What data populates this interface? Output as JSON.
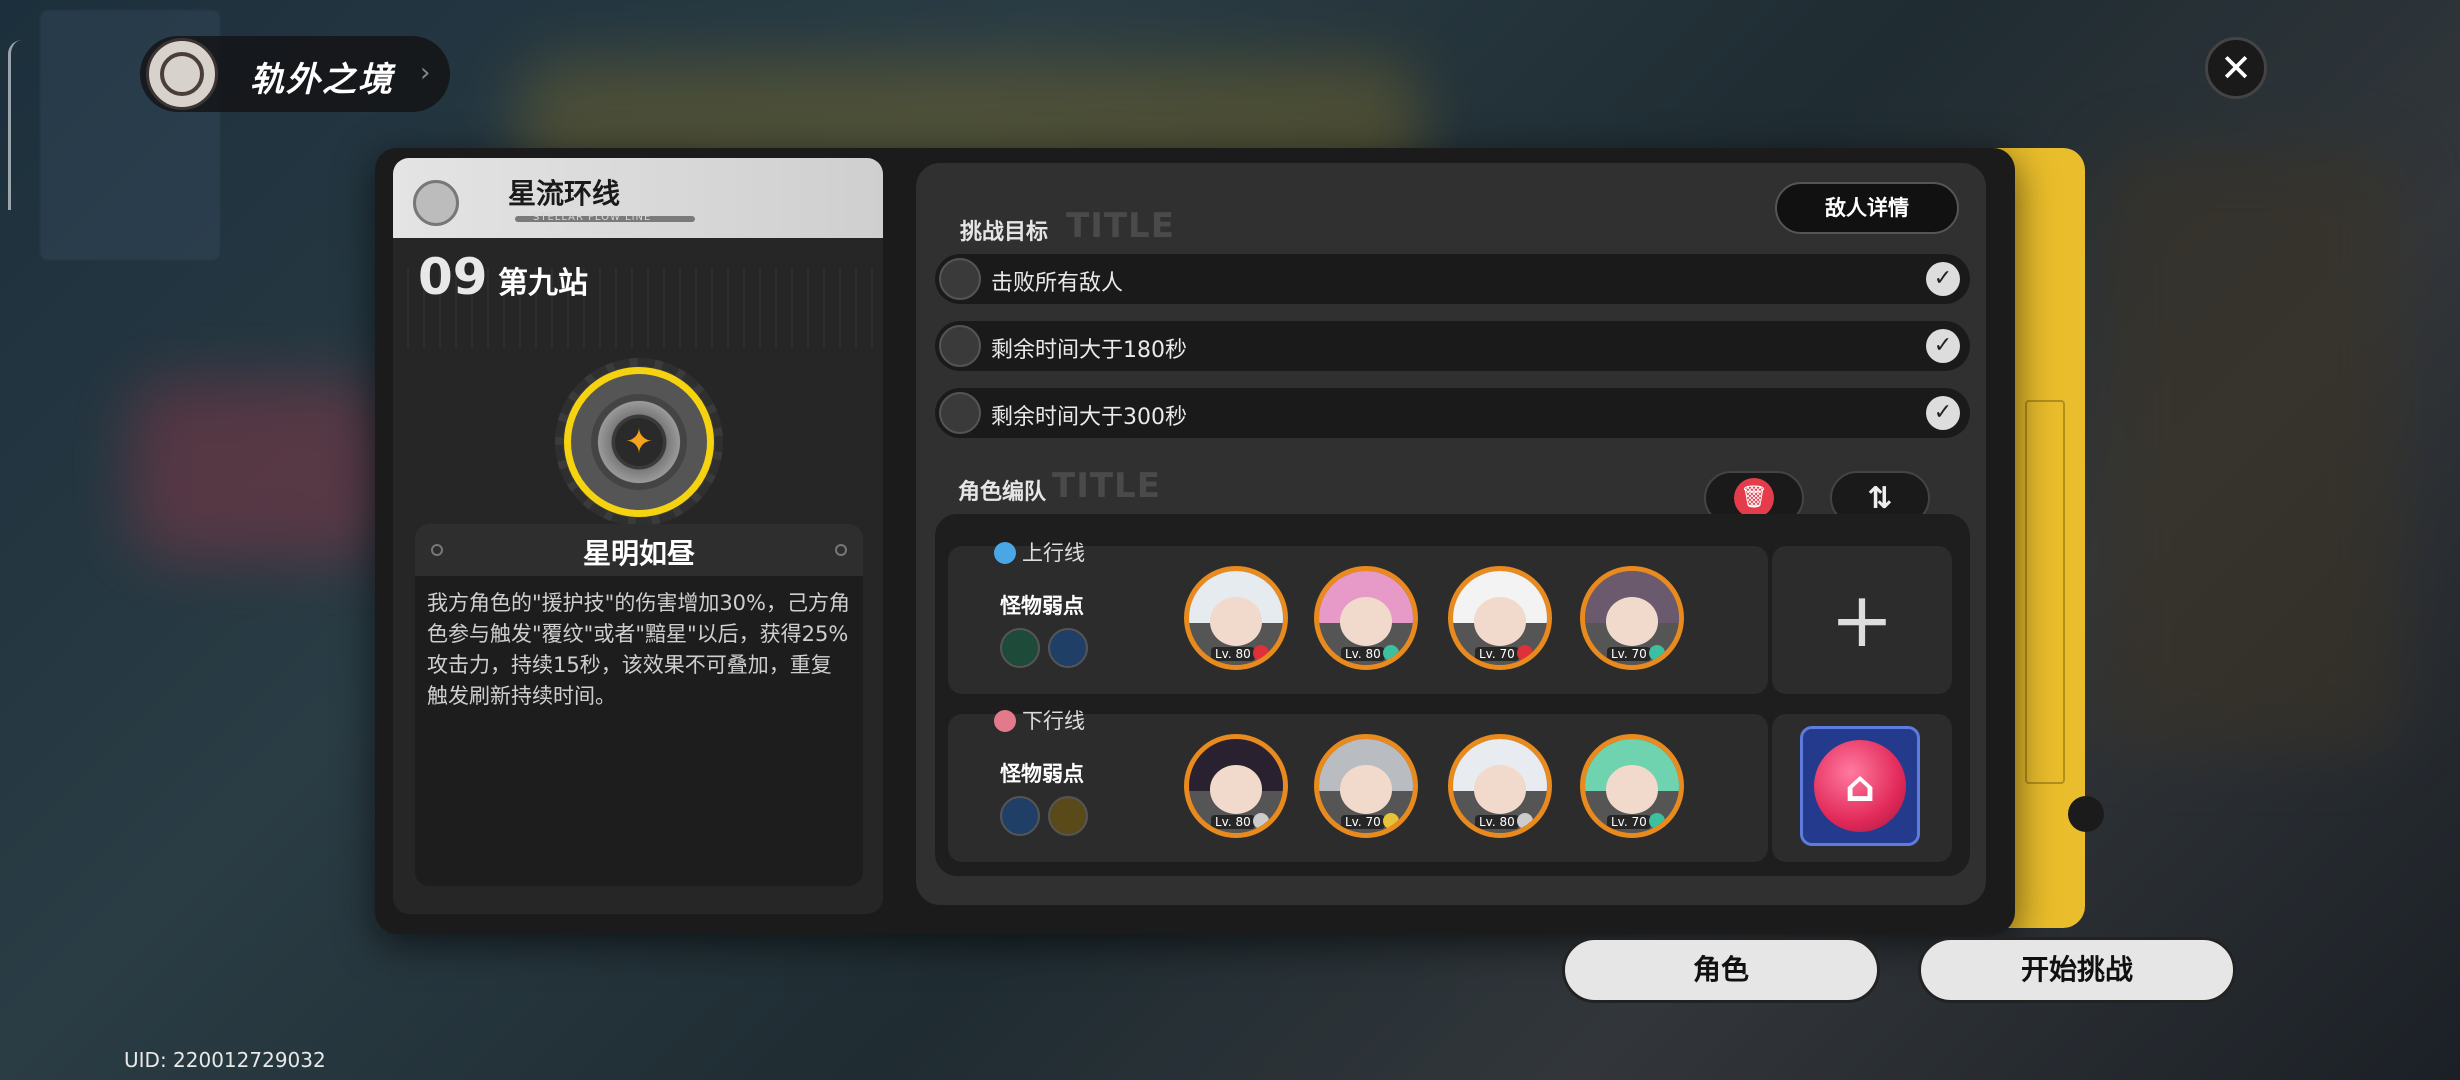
{
  "header": {
    "title": "轨外之境"
  },
  "stage_card": {
    "line_name": "星流环线",
    "line_subtitle": "STELLAR FLOW LINE",
    "stage_number": "09",
    "stage_name": "第九站",
    "buff": {
      "title": "星明如昼",
      "description": "我方角色的\"援护技\"的伤害增加30%，己方角色参与触发\"覆纹\"或者\"黯星\"以后，获得25%攻击力，持续15秒，该效果不可叠加，重复触发刷新持续时间。"
    }
  },
  "challenge": {
    "section_title": "挑战目标",
    "section_deco": "TITLE",
    "enemy_details_button": "敌人详情",
    "objectives": [
      {
        "text": "击败所有敌人",
        "completed": true
      },
      {
        "text": "剩余时间大于180秒",
        "completed": true
      },
      {
        "text": "剩余时间大于300秒",
        "completed": true
      }
    ]
  },
  "team": {
    "section_title": "角色编队",
    "section_deco": "TITLE",
    "lines": [
      {
        "name": "上行线",
        "tag_color": "#4aa7e6",
        "weakness_label": "怪物弱点",
        "weaknesses": [
          "wind-element-icon",
          "ice-element-icon"
        ],
        "characters": [
          {
            "level": "Lv. 80",
            "hair": "#e6ebf0",
            "element_color": "#e0303a"
          },
          {
            "level": "Lv. 80",
            "hair": "#e79ac8",
            "element_color": "#3cc0a0"
          },
          {
            "level": "Lv. 70",
            "hair": "#f3f3f3",
            "element_color": "#e0303a"
          },
          {
            "level": "Lv. 70",
            "hair": "#6b5a6e",
            "element_color": "#3cc0a0"
          }
        ],
        "extra_slot": "add"
      },
      {
        "name": "下行线",
        "tag_color": "#e27a8c",
        "weakness_label": "怪物弱点",
        "weaknesses": [
          "ice-element-icon",
          "light-element-icon"
        ],
        "characters": [
          {
            "level": "Lv. 80",
            "hair": "#2a2130",
            "element_color": "#cccccc"
          },
          {
            "level": "Lv. 70",
            "hair": "#b9bcc0",
            "element_color": "#e8c23a"
          },
          {
            "level": "Lv. 80",
            "hair": "#e8ecf0",
            "element_color": "#cccccc"
          },
          {
            "level": "Lv. 70",
            "hair": "#6fd3b0",
            "element_color": "#3cc0a0"
          }
        ],
        "extra_slot": "support"
      }
    ]
  },
  "buttons": {
    "character": "角色",
    "start": "开始挑战"
  },
  "uid": "UID: 220012729032",
  "colors": {
    "accent_yellow": "#e9bd2b",
    "medal_ring": "#f5d310",
    "avatar_border": "#e88a1e"
  }
}
